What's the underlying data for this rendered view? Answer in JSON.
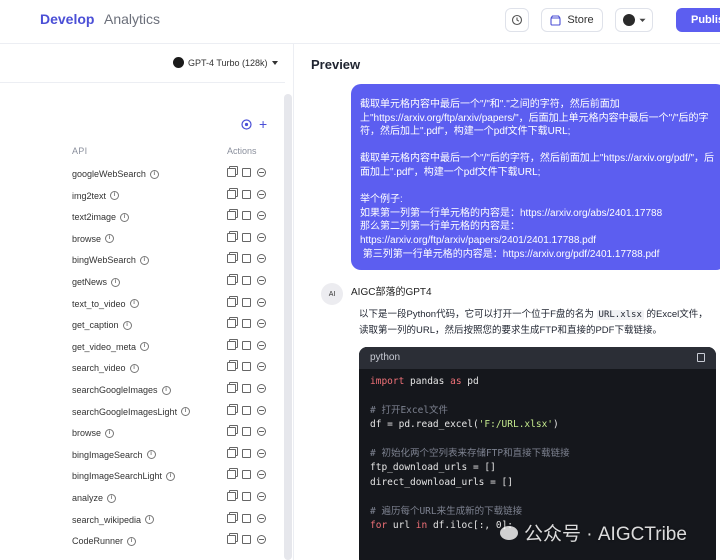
{
  "nav": {
    "develop": "Develop",
    "analytics": "Analytics"
  },
  "header": {
    "store": "Store",
    "publish": "Publish"
  },
  "left": {
    "model": "GPT-4 Turbo (128k)",
    "col_api": "API",
    "col_actions": "Actions",
    "apis": [
      "googleWebSearch",
      "img2text",
      "text2image",
      "browse",
      "bingWebSearch",
      "getNews",
      "text_to_video",
      "get_caption",
      "get_video_meta",
      "search_video",
      "searchGoogleImages",
      "searchGoogleImagesLight",
      "browse",
      "bingImageSearch",
      "bingImageSearchLight",
      "analyze",
      "search_wikipedia",
      "CodeRunner"
    ]
  },
  "preview": {
    "title": "Preview",
    "user_message": [
      "截取单元格内容中最后一个\"/\"和\".\"之间的字符，然后前面加上\"https://arxiv.org/ftp/arxiv/papers/\"，后面加上单元格内容中最后一个\"/\"后的字符，然后加上\".pdf\"，构建一个pdf文件下载URL;",
      "截取单元格内容中最后一个\"/\"后的字符，然后前面加上\"https://arxiv.org/pdf/\"，后面加上\".pdf\"，构建一个pdf文件下载URL;",
      "举个例子:\n如果第一列第一行单元格的内容是：https://arxiv.org/abs/2401.17788\n那么第二列第一行单元格的内容是：\nhttps://arxiv.org/ftp/arxiv/papers/2401/2401.17788.pdf\n 第三列第一行单元格的内容是：https://arxiv.org/pdf/2401.17788.pdf"
    ],
    "bot_name": "AIGC部落的GPT4",
    "bot_text_1": "以下是一段Python代码，它可以打开一个位于F盘的名为",
    "bot_code_inline": "URL.xlsx",
    "bot_text_2": "的Excel文件，读取第一列的URL，然后按照您的要求生成FTP和直接的PDF下载链接。",
    "code_lang": "python",
    "code": {
      "l1_kw": "import",
      "l1_rest": " pandas ",
      "l1_kw2": "as",
      "l1_end": " pd",
      "l2": "# 打开Excel文件",
      "l3_a": "df = pd.read_excel(",
      "l3_str": "'F:/URL.xlsx'",
      "l3_b": ")",
      "l4": "# 初始化两个空列表来存储FTP和直接下载链接",
      "l5": "ftp_download_urls = []",
      "l6": "direct_download_urls = []",
      "l7": "# 遍历每个URL来生成新的下载链接",
      "l8_kw": "for",
      "l8_a": " url ",
      "l8_kw2": "in",
      "l8_b": " df.iloc[:, 0]:"
    },
    "watermark": "公众号 · AIGCTribe"
  }
}
